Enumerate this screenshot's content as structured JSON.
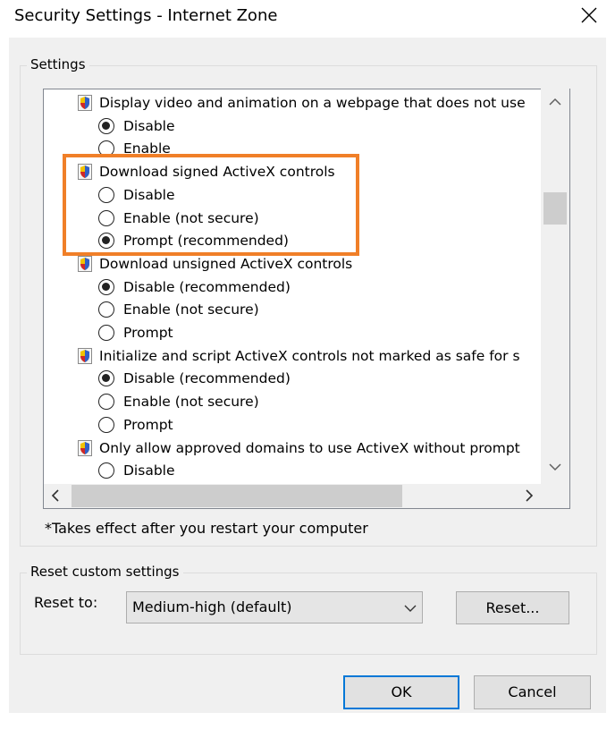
{
  "window": {
    "title": "Security Settings - Internet Zone",
    "close_icon": "close-icon"
  },
  "settings_group": {
    "label": "Settings"
  },
  "settings_list": {
    "items": [
      {
        "kind": "header",
        "text": "Display video and animation on a webpage that does not use"
      },
      {
        "kind": "option",
        "text": "Disable",
        "checked": true
      },
      {
        "kind": "option",
        "text": "Enable",
        "checked": false
      },
      {
        "kind": "header",
        "text": "Download signed ActiveX controls"
      },
      {
        "kind": "option",
        "text": "Disable",
        "checked": false
      },
      {
        "kind": "option",
        "text": "Enable (not secure)",
        "checked": false
      },
      {
        "kind": "option",
        "text": "Prompt (recommended)",
        "checked": true
      },
      {
        "kind": "header",
        "text": "Download unsigned ActiveX controls"
      },
      {
        "kind": "option",
        "text": "Disable (recommended)",
        "checked": true
      },
      {
        "kind": "option",
        "text": "Enable (not secure)",
        "checked": false
      },
      {
        "kind": "option",
        "text": "Prompt",
        "checked": false
      },
      {
        "kind": "header",
        "text": "Initialize and script ActiveX controls not marked as safe for s"
      },
      {
        "kind": "option",
        "text": "Disable (recommended)",
        "checked": true
      },
      {
        "kind": "option",
        "text": "Enable (not secure)",
        "checked": false
      },
      {
        "kind": "option",
        "text": "Prompt",
        "checked": false
      },
      {
        "kind": "header",
        "text": "Only allow approved domains to use ActiveX without prompt"
      },
      {
        "kind": "option",
        "text": "Disable",
        "checked": false
      }
    ]
  },
  "footnote": "*Takes effect after you restart your computer",
  "reset_group": {
    "label": "Reset custom settings",
    "reset_to_label": "Reset to:",
    "reset_to_value": "Medium-high (default)",
    "reset_button": "Reset..."
  },
  "buttons": {
    "ok": "OK",
    "cancel": "Cancel"
  },
  "colors": {
    "highlight": "#f07f28",
    "default_button_border": "#0078d7"
  }
}
